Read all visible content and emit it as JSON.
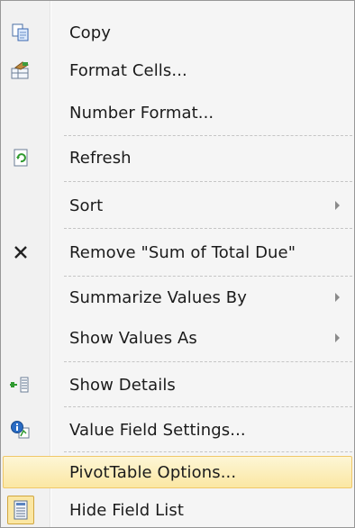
{
  "menu": {
    "items": [
      {
        "label": "Copy",
        "icon": "copy-icon",
        "submenu": false
      },
      {
        "label": "Format Cells...",
        "icon": "format-cells-icon",
        "submenu": false
      },
      {
        "label": "Number Format...",
        "icon": null,
        "submenu": false
      },
      {
        "label": "Refresh",
        "icon": "refresh-icon",
        "submenu": false
      },
      {
        "label": "Sort",
        "icon": null,
        "submenu": true
      },
      {
        "label": "Remove \"Sum of Total Due\"",
        "icon": "remove-icon",
        "submenu": false
      },
      {
        "label": "Summarize Values By",
        "icon": null,
        "submenu": true
      },
      {
        "label": "Show Values As",
        "icon": null,
        "submenu": true
      },
      {
        "label": "Show Details",
        "icon": "show-details-icon",
        "submenu": false
      },
      {
        "label": "Value Field Settings...",
        "icon": "value-field-settings-icon",
        "submenu": false
      },
      {
        "label": "PivotTable Options...",
        "icon": null,
        "submenu": false,
        "highlighted": true
      },
      {
        "label": "Hide Field List",
        "icon": "field-list-icon",
        "submenu": false,
        "checked": true
      }
    ]
  }
}
